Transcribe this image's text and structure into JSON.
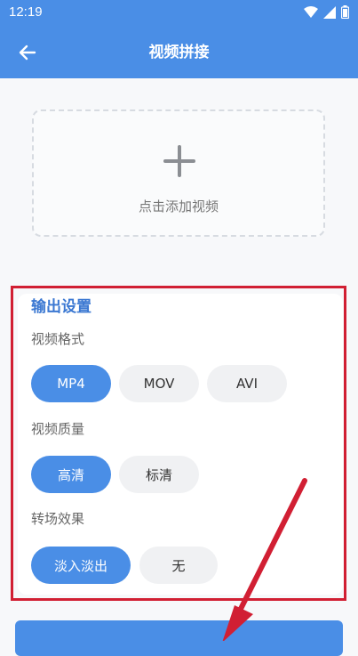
{
  "status": {
    "time": "12:19"
  },
  "appbar": {
    "title": "视频拼接"
  },
  "add_video": {
    "label": "点击添加视频"
  },
  "settings": {
    "title": "输出设置",
    "format": {
      "label": "视频格式",
      "options": [
        "MP4",
        "MOV",
        "AVI"
      ],
      "selected": "MP4"
    },
    "quality": {
      "label": "视频质量",
      "options": [
        "高清",
        "标清"
      ],
      "selected": "高清"
    },
    "transition": {
      "label": "转场效果",
      "options": [
        "淡入淡出",
        "无"
      ],
      "selected": "淡入淡出"
    }
  },
  "colors": {
    "accent": "#4a8ee6",
    "highlight_frame": "#d11f33"
  }
}
